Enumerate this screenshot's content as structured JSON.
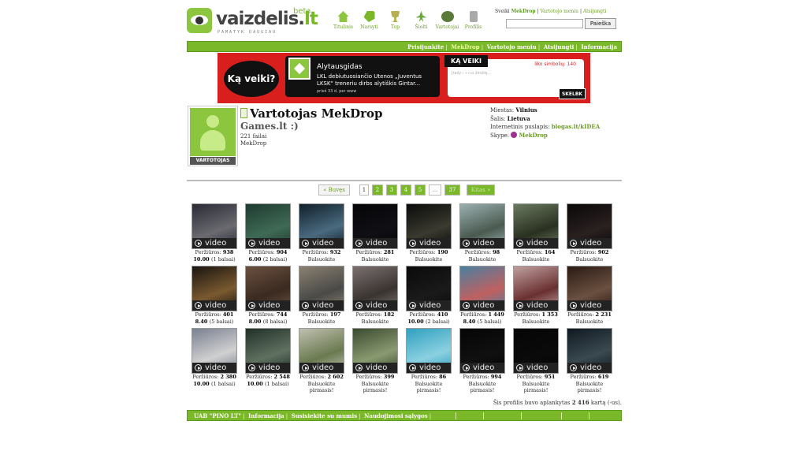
{
  "brand": {
    "name_main": "vaizdelis.",
    "name_tld": "lt",
    "beta": "beta",
    "tagline": "PAMATYK DAUGIAU"
  },
  "top_nav": [
    {
      "label": "Titulinis",
      "icon": "home-icon"
    },
    {
      "label": "Narsyti",
      "icon": "tag-icon"
    },
    {
      "label": "Top",
      "icon": "trophy-icon"
    },
    {
      "label": "Šiolti",
      "icon": "hot-icon"
    },
    {
      "label": "Vartotojai",
      "icon": "users-icon"
    },
    {
      "label": "Profilis",
      "icon": "lock-icon"
    }
  ],
  "user_box": {
    "greeting": "Sveiki",
    "username": "MekDrop",
    "menu": "Vartotojo meniu",
    "logout": "Atsijungti"
  },
  "search": {
    "placeholder": "",
    "button": "Paieška"
  },
  "green_bar": {
    "login": "Prisijunkite",
    "user": "MekDrop",
    "menu": "Vartotojo meniu",
    "logout": "Atsijungti",
    "info": "Informacija"
  },
  "banner": {
    "ka_veiki": "Ką veiki?",
    "news_title": "Alytausgidas",
    "news_text": "LKL debiutuosiančio Utenos „Juventus LKSK“ treneriu dirbs alytiškis Gintar...",
    "news_date": "prieš 33 d. per www",
    "ka_veiki_tu": "KĄ VEIKI TU?",
    "limit": "liko simbolių: 140",
    "input_placeholder": "Įrašyk savo žinutę...",
    "submit": "SKELBK"
  },
  "profile": {
    "avatar_label": "VARTOTOJAS",
    "title": "Vartotojas MekDrop",
    "subtitle": "Games.lt :)",
    "files": "221 failai",
    "username": "MekDrop",
    "city_label": "Miestas:",
    "city": "Vilnius",
    "country_label": "Šalis:",
    "country": "Lietuva",
    "web_label": "Internetinis puslapis:",
    "web": "blogas.lt/kIDEA",
    "skype_label": "Skype:",
    "skype": "MekDrop"
  },
  "pager": {
    "prev": "« Buvęs",
    "current": "1",
    "pages": [
      "2",
      "3",
      "4",
      "5"
    ],
    "dots": "...",
    "last": "37",
    "next": "Kitas »"
  },
  "video_label": "video",
  "videos": [
    {
      "views_label": "Peržiūros:",
      "views": "938",
      "line2_bold": "10.00",
      "line2": "(1 balsai)",
      "line3": ""
    },
    {
      "views_label": "Peržiūros:",
      "views": "904",
      "line2_bold": "6.00",
      "line2": "(2 balsai)",
      "line3": ""
    },
    {
      "views_label": "Peržiūros:",
      "views": "932",
      "line2_bold": "",
      "line2": "Balsuokite",
      "line3": ""
    },
    {
      "views_label": "Peržiūros:",
      "views": "281",
      "line2_bold": "",
      "line2": "Balsuokite",
      "line3": ""
    },
    {
      "views_label": "Peržiūros:",
      "views": "190",
      "line2_bold": "",
      "line2": "Balsuokite",
      "line3": ""
    },
    {
      "views_label": "Peržiūros:",
      "views": "98",
      "line2_bold": "",
      "line2": "Balsuokite",
      "line3": ""
    },
    {
      "views_label": "Peržiūros:",
      "views": "164",
      "line2_bold": "",
      "line2": "Balsuokite",
      "line3": ""
    },
    {
      "views_label": "Peržiūros:",
      "views": "902",
      "line2_bold": "",
      "line2": "Balsuokite",
      "line3": ""
    },
    {
      "views_label": "Peržiūros:",
      "views": "401",
      "line2_bold": "8.40",
      "line2": "(5 balsai)",
      "line3": ""
    },
    {
      "views_label": "Peržiūros:",
      "views": "744",
      "line2_bold": "8.00",
      "line2": "(8 balsai)",
      "line3": ""
    },
    {
      "views_label": "Peržiūros:",
      "views": "197",
      "line2_bold": "",
      "line2": "Balsuokite",
      "line3": ""
    },
    {
      "views_label": "Peržiūros:",
      "views": "182",
      "line2_bold": "",
      "line2": "Balsuokite",
      "line3": ""
    },
    {
      "views_label": "Peržiūros:",
      "views": "410",
      "line2_bold": "10.00",
      "line2": "(2 balsai)",
      "line3": ""
    },
    {
      "views_label": "Peržiūros:",
      "views": "1 449",
      "line2_bold": "8.40",
      "line2": "(5 balsai)",
      "line3": ""
    },
    {
      "views_label": "Peržiūros:",
      "views": "1 353",
      "line2_bold": "",
      "line2": "Balsuokite",
      "line3": ""
    },
    {
      "views_label": "Peržiūros:",
      "views": "2 231",
      "line2_bold": "",
      "line2": "Balsuokite",
      "line3": ""
    },
    {
      "views_label": "Peržiūros:",
      "views": "2 380",
      "line2_bold": "10.00",
      "line2": "(1 balsai)",
      "line3": ""
    },
    {
      "views_label": "Peržiūros:",
      "views": "2 548",
      "line2_bold": "10.00",
      "line2": "(1 balsai)",
      "line3": ""
    },
    {
      "views_label": "Peržiūros:",
      "views": "2 602",
      "line2_bold": "",
      "line2": "Balsuokite",
      "line3": "pirmasis!"
    },
    {
      "views_label": "Peržiūros:",
      "views": "399",
      "line2_bold": "",
      "line2": "Balsuokite",
      "line3": "pirmasis!"
    },
    {
      "views_label": "Peržiūros:",
      "views": "86",
      "line2_bold": "",
      "line2": "Balsuokite",
      "line3": "pirmasis!"
    },
    {
      "views_label": "Peržiūros:",
      "views": "994",
      "line2_bold": "",
      "line2": "Balsuokite",
      "line3": "pirmasis!"
    },
    {
      "views_label": "Peržiūros:",
      "views": "951",
      "line2_bold": "",
      "line2": "Balsuokite",
      "line3": "pirmasis!"
    },
    {
      "views_label": "Peržiūros:",
      "views": "619",
      "line2_bold": "",
      "line2": "Balsuokite",
      "line3": "pirmasis!"
    }
  ],
  "visits": {
    "prefix": "Šis profilis buvo aplankytas",
    "count": "2 416",
    "suffix": "kartą (-us)."
  },
  "footer": {
    "company": "UAB \"PINO LT\"",
    "info": "Informacija",
    "contact": "Susisiekite su mumis",
    "terms": "Naudojimosi sąlygos"
  }
}
